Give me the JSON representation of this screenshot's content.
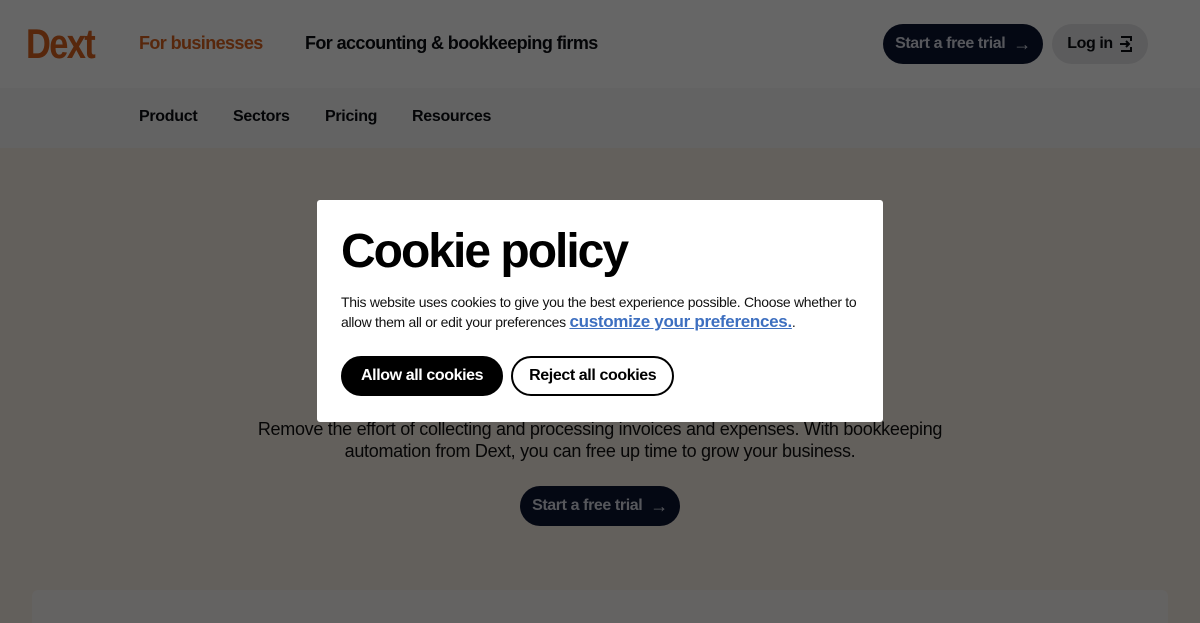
{
  "header": {
    "logo": "Dext",
    "segments": [
      {
        "label": "For businesses",
        "active": true
      },
      {
        "label": "For accounting & bookkeeping firms",
        "active": false
      }
    ],
    "trial_button": "Start a free trial",
    "login_button": "Log in",
    "brand_color": "#d9631e"
  },
  "subnav": {
    "items": [
      {
        "label": "Product"
      },
      {
        "label": "Sectors"
      },
      {
        "label": "Pricing"
      },
      {
        "label": "Resources"
      }
    ]
  },
  "hero": {
    "description_line1": "Remove the effort of collecting and processing invoices and expenses. With bookkeeping",
    "description_line2": "automation from Dext, you can free up time to grow your business.",
    "trial_button": "Start a free trial"
  },
  "cookie_modal": {
    "title": "Cookie policy",
    "body": "This website uses cookies to give you the best experience possible. Choose whether to allow them all or edit your preferences ",
    "link": "customize your preferences.",
    "body_end": ".",
    "allow_button": "Allow all cookies",
    "reject_button": "Reject all cookies",
    "link_color": "#3d6fc0"
  },
  "icons": {
    "arrow": "→"
  }
}
